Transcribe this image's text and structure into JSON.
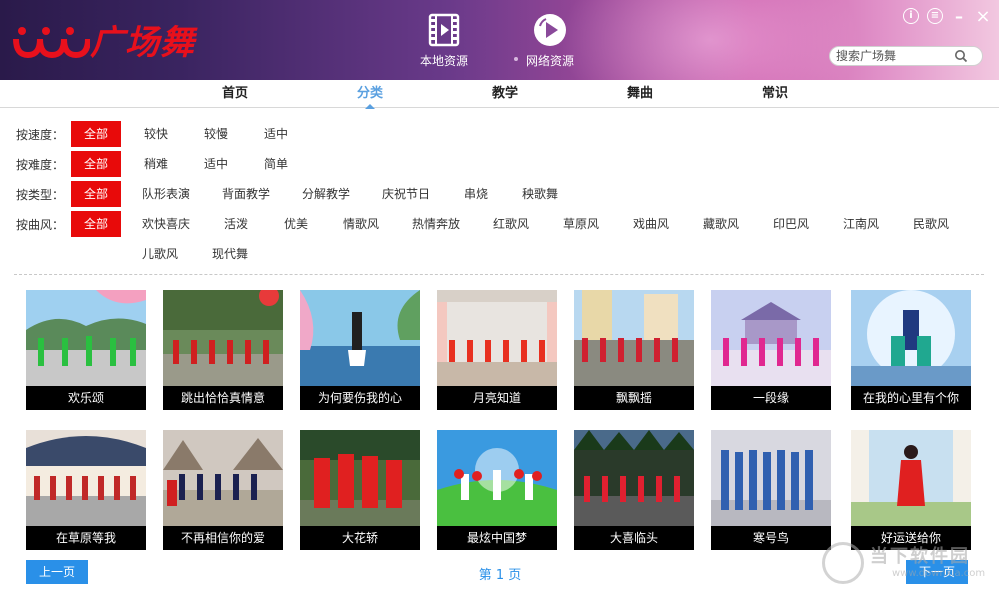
{
  "app": {
    "logo_text": "广场舞",
    "local_resource": "本地资源",
    "net_resource": "网络资源",
    "search_placeholder": "搜索广场舞"
  },
  "window_controls": {
    "info": "i",
    "menu": "≡",
    "minimize": "–",
    "close": "×"
  },
  "tabs": [
    {
      "label": "首页",
      "active": false
    },
    {
      "label": "分类",
      "active": true
    },
    {
      "label": "教学",
      "active": false
    },
    {
      "label": "舞曲",
      "active": false
    },
    {
      "label": "常识",
      "active": false
    }
  ],
  "filters": {
    "speed": {
      "label": "按速度：",
      "options": [
        "全部",
        "较快",
        "较慢",
        "适中"
      ],
      "selected": "全部"
    },
    "difficulty": {
      "label": "按难度：",
      "options": [
        "全部",
        "稍难",
        "适中",
        "简单"
      ],
      "selected": "全部"
    },
    "type": {
      "label": "按类型：",
      "options": [
        "全部",
        "队形表演",
        "背面教学",
        "分解教学",
        "庆祝节日",
        "串烧",
        "秧歌舞"
      ],
      "selected": "全部"
    },
    "style": {
      "label": "按曲风：",
      "options": [
        "全部",
        "欢快喜庆",
        "活泼",
        "优美",
        "情歌风",
        "热情奔放",
        "红歌风",
        "草原风",
        "戏曲风",
        "藏歌风",
        "印巴风",
        "江南风",
        "民歌风",
        "儿歌风",
        "现代舞"
      ],
      "selected": "全部"
    }
  },
  "videos": [
    {
      "title": "欢乐颂"
    },
    {
      "title": "跳出恰恰真情意"
    },
    {
      "title": "为何要伤我的心"
    },
    {
      "title": "月亮知道"
    },
    {
      "title": "飘飘摇"
    },
    {
      "title": "一段缘"
    },
    {
      "title": "在我的心里有个你"
    },
    {
      "title": "在草原等我"
    },
    {
      "title": "不再相信你的爱"
    },
    {
      "title": "大花轿"
    },
    {
      "title": "最炫中国梦"
    },
    {
      "title": "大喜临头"
    },
    {
      "title": "寒号鸟"
    },
    {
      "title": "好运送给你"
    }
  ],
  "pager": {
    "prev": "上一页",
    "next": "下一页",
    "info": "第 1 页"
  },
  "watermark": {
    "line1": "当下软件园",
    "line2": "www.downxia.com"
  },
  "colors": {
    "accent_red": "#e80a0a",
    "accent_blue": "#2a90e8",
    "tab_active": "#5aa0e0"
  }
}
